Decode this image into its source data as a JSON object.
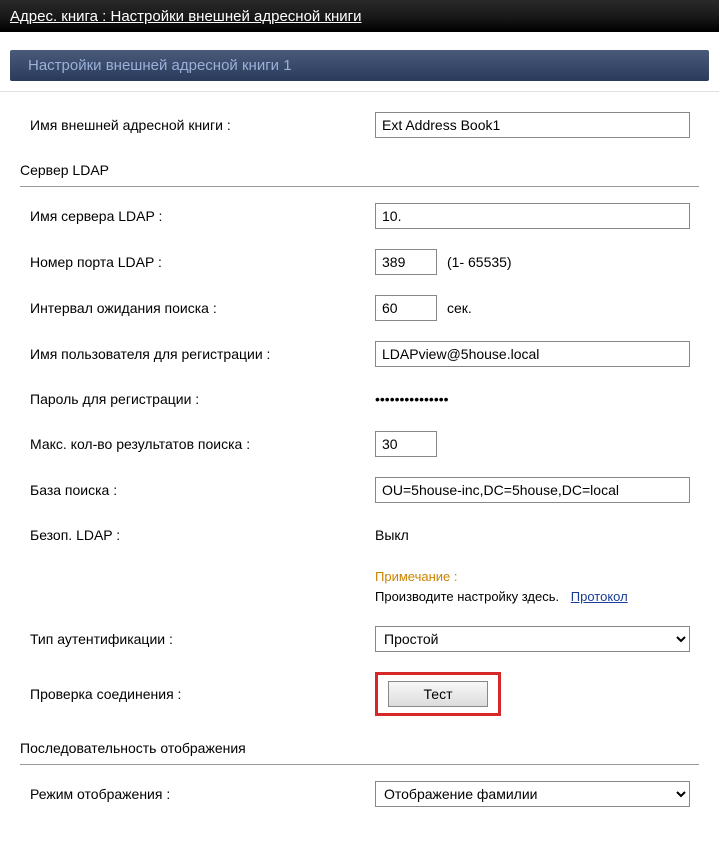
{
  "header": {
    "breadcrumb": "Адрес. книга : Настройки внешней адресной книги"
  },
  "subheader": {
    "title": "Настройки внешней адресной книги 1"
  },
  "fields": {
    "name_label": "Имя внешней адресной книги :",
    "name_value": "Ext Address Book1",
    "ldap_section": "Сервер LDAP",
    "server_label": "Имя сервера LDAP :",
    "server_value": "10.",
    "port_label": "Номер порта LDAP :",
    "port_value": "389",
    "port_range": "(1- 65535)",
    "timeout_label": "Интервал ожидания поиска :",
    "timeout_value": "60",
    "timeout_unit": "сек.",
    "user_label": "Имя пользователя для регистрации :",
    "user_value": "LDAPview@5house.local",
    "password_label": "Пароль для регистрации :",
    "password_value": "•••••••••••••••",
    "maxres_label": "Макс. кол-во результатов поиска :",
    "maxres_value": "30",
    "base_label": "База поиска :",
    "base_value": "OU=5house-inc,DC=5house,DC=local",
    "secure_label": "Безоп. LDAP :",
    "secure_value": "Выкл",
    "note_label": "Примечание :",
    "note_text": "Производите настройку здесь.",
    "note_link": "Протокол",
    "auth_label": "Тип аутентификации :",
    "auth_value": "Простой",
    "check_label": "Проверка соединения :",
    "test_button": "Тест",
    "order_section": "Последовательность отображения",
    "mode_label": "Режим отображения :",
    "mode_value": "Отображение фамилии"
  }
}
